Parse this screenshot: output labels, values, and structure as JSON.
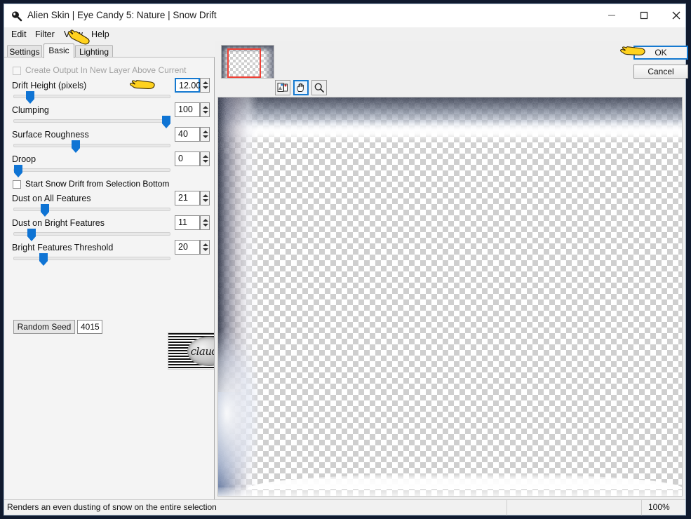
{
  "window": {
    "title": "Alien Skin | Eye Candy 5: Nature | Snow Drift",
    "app_icon": "alien-skin-icon",
    "minimize": "minimize-icon",
    "maximize": "maximize-icon",
    "close": "close-icon"
  },
  "menubar": {
    "items": [
      {
        "label": "Edit"
      },
      {
        "label": "Filter"
      },
      {
        "label": "View"
      },
      {
        "label": "Help"
      }
    ]
  },
  "tabs": [
    {
      "label": "Settings",
      "active": false
    },
    {
      "label": "Basic",
      "active": true
    },
    {
      "label": "Lighting",
      "active": false
    }
  ],
  "params": {
    "output_checkbox": {
      "label": "Create Output In New Layer Above Current",
      "checked": false,
      "disabled": true
    },
    "selection_bottom_checkbox": {
      "label": "Start Snow Drift from Selection Bottom",
      "checked": false,
      "disabled": false
    },
    "sliders": [
      {
        "label": "Drift Height (pixels)",
        "value": "12.00",
        "percent": 12,
        "focused": true
      },
      {
        "label": "Clumping",
        "value": "100",
        "percent": 100,
        "focused": false
      },
      {
        "label": "Surface Roughness",
        "value": "40",
        "percent": 40,
        "focused": false
      },
      {
        "label": "Droop",
        "value": "0",
        "percent": 0,
        "focused": false
      },
      {
        "label": "Dust on All Features",
        "value": "21",
        "percent": 21,
        "focused": false
      },
      {
        "label": "Dust on Bright Features",
        "value": "11",
        "percent": 11,
        "focused": false
      },
      {
        "label": "Bright Features Threshold",
        "value": "20",
        "percent": 20,
        "focused": false
      }
    ],
    "random_seed": {
      "button_label": "Random Seed",
      "value": "4015"
    }
  },
  "watermark": {
    "text": "claudia"
  },
  "preview": {
    "navigator_icon": "navigator-thumbnail",
    "viewport_marker": "red-viewport-rect",
    "tools": [
      {
        "name": "before-after-icon",
        "active": false
      },
      {
        "name": "hand-tool-icon",
        "active": true
      },
      {
        "name": "zoom-tool-icon",
        "active": false
      }
    ]
  },
  "buttons": {
    "ok": "OK",
    "cancel": "Cancel"
  },
  "statusbar": {
    "message": "Renders an even dusting of snow on the entire selection",
    "zoom": "100%"
  },
  "colors": {
    "accent_blue": "#1579d0",
    "slider_blue": "#0f74d4",
    "viewport_red": "#ef4136",
    "panel_bg": "#f4f4f4",
    "cursor_yellow": "#ffd21e"
  }
}
